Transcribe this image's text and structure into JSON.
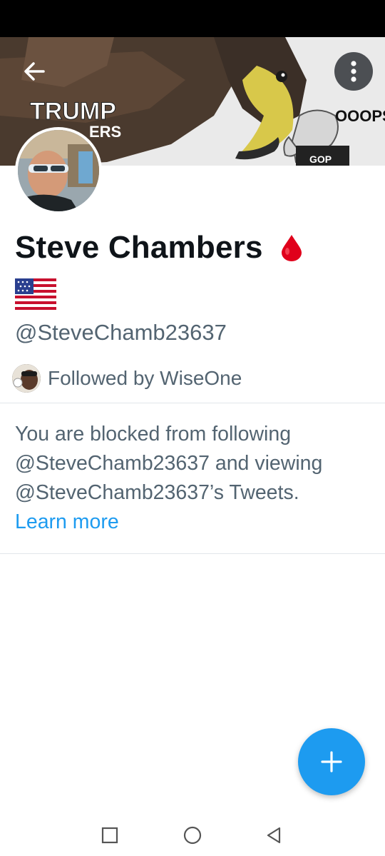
{
  "header": {
    "banner_text_trump": "TRUMP",
    "banner_text_fragment": "ERS",
    "banner_text_ooops": "OOOPS!",
    "banner_text_gop": "GOP",
    "back_icon": "arrow-left-icon",
    "more_icon": "more-vertical-icon"
  },
  "profile": {
    "name": "Steve Chambers",
    "name_emoji": "drop-of-blood",
    "flag_emoji": "us-flag",
    "handle": "@SteveChamb23637",
    "followed_by": "Followed by WiseOne"
  },
  "blocked": {
    "message": "You are blocked from following @SteveChamb23637 and viewing @SteveChamb23637’s Tweets.",
    "link": "Learn more"
  },
  "fab": {
    "icon": "plus-icon"
  },
  "navbar": {
    "recent": "square-icon",
    "home": "circle-icon",
    "back": "triangle-back-icon"
  },
  "colors": {
    "accent": "#1d9bf0",
    "secondary_text": "#536471",
    "blood": "#e0001b"
  }
}
